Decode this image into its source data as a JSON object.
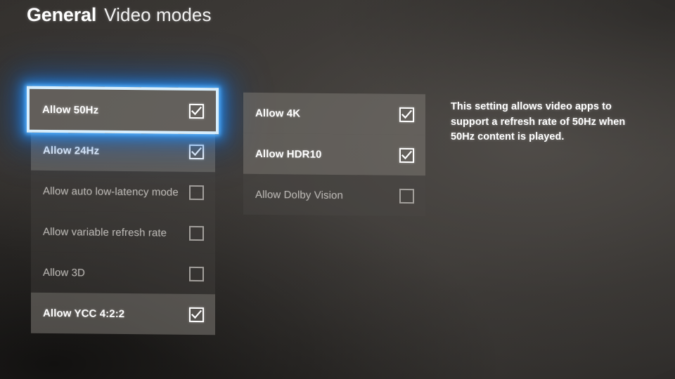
{
  "header": {
    "breadcrumb_bold": "General",
    "breadcrumb_light": "Video modes"
  },
  "colors": {
    "focus_border": "#d8eefc",
    "focus_glow": "#1a8fe0",
    "row_enabled_bg": "#7e7a75",
    "row_disabled_bg": "#4a4744",
    "background": "#393633",
    "text_primary": "#ffffff",
    "text_dim": "#b9b6b2"
  },
  "columns": [
    {
      "name": "refresh-and-format-options",
      "rows": [
        {
          "label": "Allow 50Hz",
          "checked": true,
          "focused": true,
          "checkbox_icon": "checkbox-checked-icon"
        },
        {
          "label": "Allow 24Hz",
          "checked": true,
          "focused": false,
          "checkbox_icon": "checkbox-checked-icon"
        },
        {
          "label": "Allow auto low-latency mode",
          "checked": false,
          "focused": false,
          "checkbox_icon": "checkbox-unchecked-icon"
        },
        {
          "label": "Allow variable refresh rate",
          "checked": false,
          "focused": false,
          "checkbox_icon": "checkbox-unchecked-icon"
        },
        {
          "label": "Allow 3D",
          "checked": false,
          "focused": false,
          "checkbox_icon": "checkbox-unchecked-icon"
        },
        {
          "label": "Allow YCC 4:2:2",
          "checked": true,
          "focused": false,
          "checkbox_icon": "checkbox-checked-icon"
        }
      ]
    },
    {
      "name": "resolution-and-hdr-options",
      "rows": [
        {
          "label": "Allow 4K",
          "checked": true,
          "focused": false,
          "checkbox_icon": "checkbox-checked-icon"
        },
        {
          "label": "Allow HDR10",
          "checked": true,
          "focused": false,
          "checkbox_icon": "checkbox-checked-icon"
        },
        {
          "label": "Allow Dolby Vision",
          "checked": false,
          "focused": false,
          "checkbox_icon": "checkbox-unchecked-icon"
        }
      ]
    }
  ],
  "description": {
    "text": "This setting allows video apps to support a refresh rate of 50Hz when 50Hz content is played."
  }
}
